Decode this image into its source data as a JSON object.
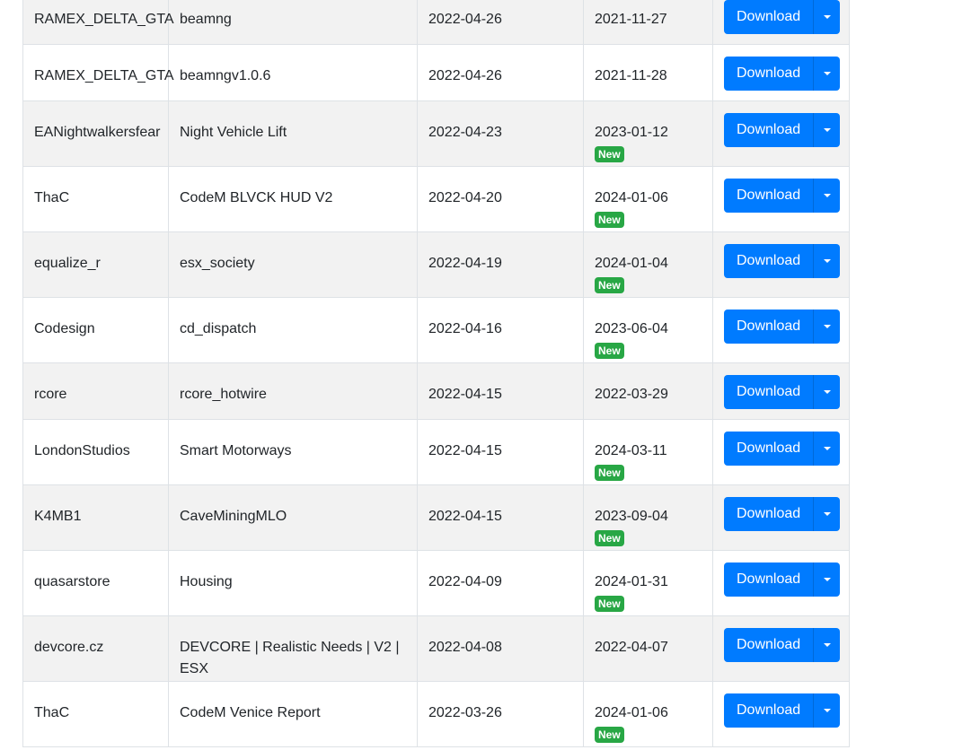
{
  "colors": {
    "primary_button": "#007bff",
    "badge_new": "#28a745",
    "row_striped": "#f2f2f2"
  },
  "rows": [
    {
      "author": "RAMEX_DELTA_GTA",
      "name": "beamng",
      "date1": "2022-04-26",
      "date2": "2021-11-27",
      "new": false,
      "button": "Download"
    },
    {
      "author": "RAMEX_DELTA_GTA",
      "name": "beamngv1.0.6",
      "date1": "2022-04-26",
      "date2": "2021-11-28",
      "new": false,
      "button": "Download"
    },
    {
      "author": "EANightwalkersfear",
      "name": "Night Vehicle Lift",
      "date1": "2022-04-23",
      "date2": "2023-01-12",
      "new": true,
      "badge": "New",
      "button": "Download"
    },
    {
      "author": "ThaC",
      "name": "CodeM BLVCK HUD V2",
      "date1": "2022-04-20",
      "date2": "2024-01-06",
      "new": true,
      "badge": "New",
      "button": "Download"
    },
    {
      "author": "equalize_r",
      "name": "esx_society",
      "date1": "2022-04-19",
      "date2": "2024-01-04",
      "new": true,
      "badge": "New",
      "button": "Download"
    },
    {
      "author": "Codesign",
      "name": "cd_dispatch",
      "date1": "2022-04-16",
      "date2": "2023-06-04",
      "new": true,
      "badge": "New",
      "button": "Download"
    },
    {
      "author": "rcore",
      "name": "rcore_hotwire",
      "date1": "2022-04-15",
      "date2": "2022-03-29",
      "new": false,
      "button": "Download"
    },
    {
      "author": "LondonStudios",
      "name": "Smart Motorways",
      "date1": "2022-04-15",
      "date2": "2024-03-11",
      "new": true,
      "badge": "New",
      "button": "Download"
    },
    {
      "author": "K4MB1",
      "name": "CaveMiningMLO",
      "date1": "2022-04-15",
      "date2": "2023-09-04",
      "new": true,
      "badge": "New",
      "button": "Download"
    },
    {
      "author": "quasarstore",
      "name": "Housing",
      "date1": "2022-04-09",
      "date2": "2024-01-31",
      "new": true,
      "badge": "New",
      "button": "Download"
    },
    {
      "author": "devcore.cz",
      "name": "DEVCORE | Realistic Needs | V2 | ESX",
      "date1": "2022-04-08",
      "date2": "2022-04-07",
      "new": false,
      "button": "Download"
    },
    {
      "author": "ThaC",
      "name": "CodeM Venice Report",
      "date1": "2022-03-26",
      "date2": "2024-01-06",
      "new": true,
      "badge": "New",
      "button": "Download"
    }
  ]
}
